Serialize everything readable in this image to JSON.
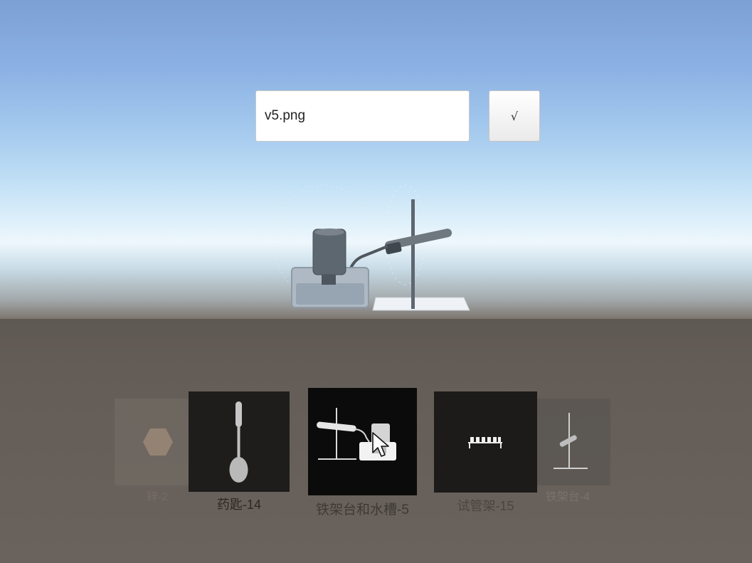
{
  "save_dialog": {
    "filename_value": "v5.png",
    "confirm_label": "√"
  },
  "carousel": {
    "items": [
      {
        "label": "锌-2",
        "icon": "hexagon-icon",
        "state": "far-left"
      },
      {
        "label": "药匙-14",
        "icon": "spoon-icon",
        "state": "left"
      },
      {
        "label": "铁架台和水槽-5",
        "icon": "iron-stand-water-trough-icon",
        "state": "selected"
      },
      {
        "label": "试管架-15",
        "icon": "test-tube-rack-icon",
        "state": "right"
      },
      {
        "label": "铁架台-4",
        "icon": "iron-stand-icon",
        "state": "far-right"
      }
    ]
  },
  "colors": {
    "sky_top": "#7c9fd4",
    "horizon": "#eef7fc",
    "ground": "#645d57",
    "card_dark": "#1c1b1a",
    "card_selected": "#0b0b0b"
  }
}
